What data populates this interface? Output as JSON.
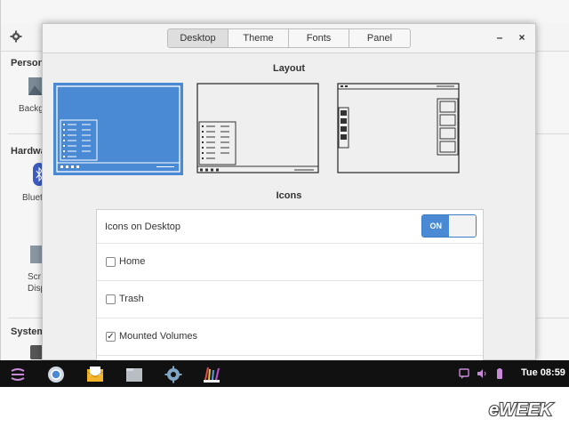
{
  "background_window": {
    "sections": [
      "Persona",
      "Hardwa",
      "System"
    ],
    "items": [
      "Backg",
      "Blueto",
      "Scr",
      "Disp"
    ]
  },
  "dialog": {
    "tabs": [
      {
        "label": "Desktop",
        "active": true
      },
      {
        "label": "Theme",
        "active": false
      },
      {
        "label": "Fonts",
        "active": false
      },
      {
        "label": "Panel",
        "active": false
      }
    ],
    "minimize_symbol": "–",
    "close_symbol": "×",
    "layout_title": "Layout",
    "layout_options": [
      "layout-option-1",
      "layout-option-2",
      "layout-option-3"
    ],
    "selected_layout": 1,
    "icons_title": "Icons",
    "icons_on_desktop_label": "Icons on Desktop",
    "toggle_label": "ON",
    "checkboxes": [
      {
        "label": "Home",
        "checked": false
      },
      {
        "label": "Trash",
        "checked": false
      },
      {
        "label": "Mounted Volumes",
        "checked": true
      }
    ]
  },
  "taskbar": {
    "apps": [
      "launcher-icon",
      "chrome-icon",
      "mail-icon",
      "files-icon",
      "settings-icon",
      "paint-icon"
    ],
    "tray": [
      "chat-icon",
      "volume-icon",
      "battery-icon"
    ],
    "clock": "Tue 08:59"
  },
  "watermark": {
    "text": "eWEEK"
  },
  "colors": {
    "accent": "#4a8ad4",
    "taskbar": "#111111",
    "tray_purple": "#c88ad8"
  }
}
